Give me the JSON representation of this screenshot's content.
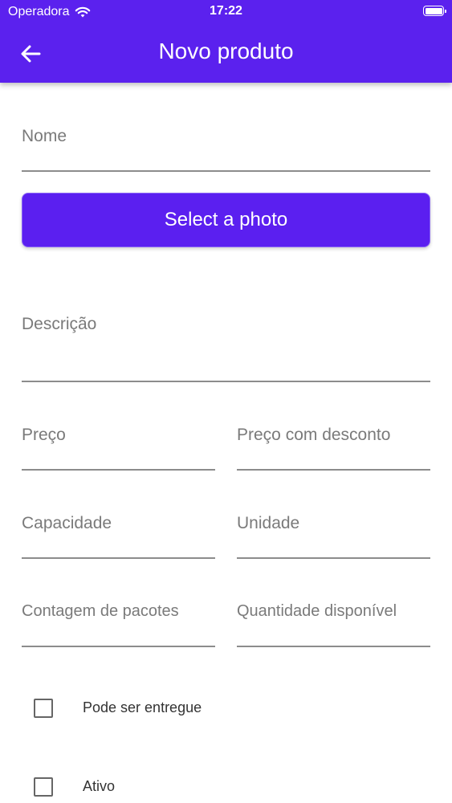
{
  "status_bar": {
    "carrier": "Operadora",
    "time": "17:22"
  },
  "app_bar": {
    "title": "Novo produto"
  },
  "form": {
    "nome": {
      "label": "Nome",
      "value": ""
    },
    "photo_button": "Select a photo",
    "descricao": {
      "label": "Descrição",
      "value": ""
    },
    "preco": {
      "label": "Preço",
      "value": ""
    },
    "preco_desconto": {
      "label": "Preço com desconto",
      "value": ""
    },
    "capacidade": {
      "label": "Capacidade",
      "value": ""
    },
    "unidade": {
      "label": "Unidade",
      "value": ""
    },
    "contagem_pacotes": {
      "label": "Contagem de pacotes",
      "value": ""
    },
    "quantidade_disponivel": {
      "label": "Quantidade disponível",
      "value": ""
    },
    "checkboxes": [
      {
        "label": "Pode ser entregue",
        "checked": false
      },
      {
        "label": "Ativo",
        "checked": false
      }
    ]
  },
  "colors": {
    "primary": "#5b21ee",
    "label_gray": "#7a7a7a",
    "underline": "#8c8c8c"
  }
}
